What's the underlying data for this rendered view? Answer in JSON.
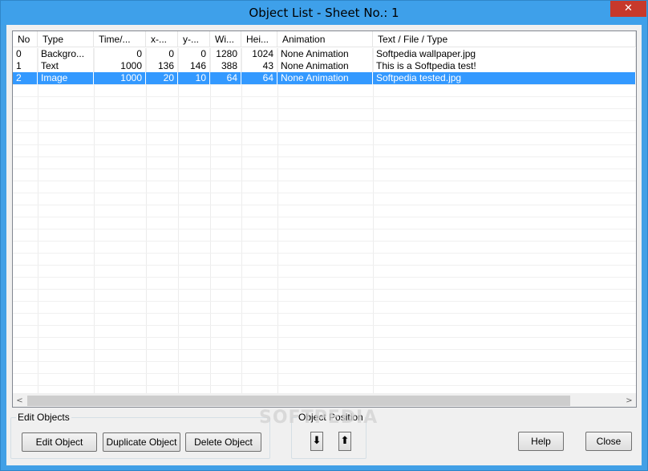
{
  "window": {
    "title": "Object List - Sheet No.: 1",
    "close_glyph": "✕"
  },
  "listview": {
    "columns": [
      "No",
      "Type",
      "Time/...",
      "x-...",
      "y-...",
      "Wi...",
      "Hei...",
      "Animation",
      "Text / File / Type"
    ],
    "rows": [
      [
        "0",
        "Backgro...",
        "0",
        "0",
        "0",
        "1280",
        "1024",
        "None Animation",
        "Softpedia wallpaper.jpg"
      ],
      [
        "1",
        "Text",
        "1000",
        "136",
        "146",
        "388",
        "43",
        "None Animation",
        "This is a Softpedia test!"
      ],
      [
        "2",
        "Image",
        "1000",
        "20",
        "10",
        "64",
        "64",
        "None Animation",
        "Softpedia tested.jpg"
      ]
    ],
    "selected_row": 2,
    "scroll_left_glyph": "<",
    "scroll_right_glyph": ">"
  },
  "edit_objects": {
    "label": "Edit Objects",
    "edit_label": "Edit Object",
    "duplicate_label": "Duplicate Object",
    "delete_label": "Delete Object"
  },
  "object_position": {
    "label": "Object Position",
    "down_glyph": "⬇",
    "up_glyph": "⬆"
  },
  "buttons": {
    "help_label": "Help",
    "close_label": "Close"
  },
  "watermark": "SOFTPEDIA",
  "colors": {
    "titlebar": "#3ea0ea",
    "close": "#c7392b",
    "selection": "#3399ff"
  }
}
